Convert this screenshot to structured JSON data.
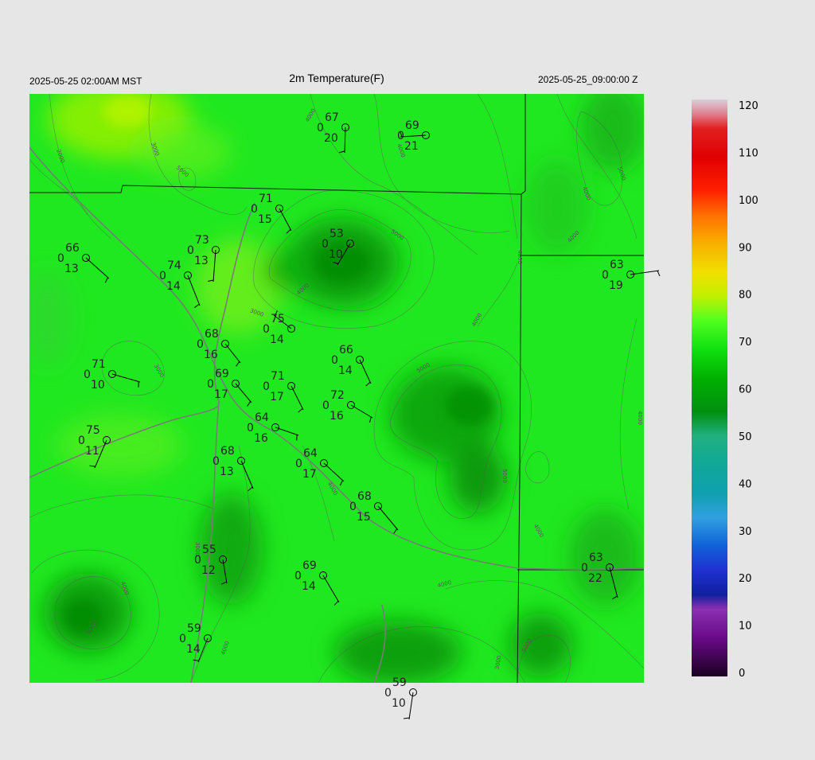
{
  "header": {
    "left_time": "2025-05-25 02:00AM MST",
    "title": "2m Temperature(F)",
    "right_time": "2025-05-25_09:00:00 Z"
  },
  "colorbar": {
    "labels": [
      "120",
      "110",
      "100",
      "90",
      "80",
      "70",
      "60",
      "50",
      "40",
      "30",
      "20",
      "10",
      "0"
    ],
    "stops": [
      {
        "v": 0,
        "c": "#1a0020"
      },
      {
        "v": 8,
        "c": "#6a0a8a"
      },
      {
        "v": 14,
        "c": "#8a30b0"
      },
      {
        "v": 17,
        "c": "#1020a0"
      },
      {
        "v": 22,
        "c": "#2030d0"
      },
      {
        "v": 27,
        "c": "#1060d8"
      },
      {
        "v": 33,
        "c": "#30a0e0"
      },
      {
        "v": 38,
        "c": "#10a0b0"
      },
      {
        "v": 44,
        "c": "#10a898"
      },
      {
        "v": 50,
        "c": "#20b080"
      },
      {
        "v": 55,
        "c": "#009010"
      },
      {
        "v": 62,
        "c": "#00b000"
      },
      {
        "v": 68,
        "c": "#10e010"
      },
      {
        "v": 74,
        "c": "#50ff20"
      },
      {
        "v": 79,
        "c": "#c0f000"
      },
      {
        "v": 84,
        "c": "#f0e000"
      },
      {
        "v": 90,
        "c": "#f8b000"
      },
      {
        "v": 96,
        "c": "#ff7000"
      },
      {
        "v": 101,
        "c": "#ff2000"
      },
      {
        "v": 108,
        "c": "#e00000"
      },
      {
        "v": 114,
        "c": "#e02020"
      },
      {
        "v": 117,
        "c": "#e08090"
      },
      {
        "v": 120,
        "c": "#d8d0d8"
      }
    ]
  },
  "contour_labels": [
    {
      "text": "2000"
    },
    {
      "text": "3000"
    },
    {
      "text": "5000"
    },
    {
      "text": "4000"
    },
    {
      "text": "5000"
    },
    {
      "text": "4000"
    },
    {
      "text": "3000"
    },
    {
      "text": "4000"
    },
    {
      "text": "3000"
    },
    {
      "text": "5000"
    },
    {
      "text": "4000"
    },
    {
      "text": "5000"
    },
    {
      "text": "4000"
    },
    {
      "text": "4000"
    },
    {
      "text": "5000"
    },
    {
      "text": "4000"
    },
    {
      "text": "3000"
    },
    {
      "text": "4000"
    },
    {
      "text": "4000"
    },
    {
      "text": "4000"
    },
    {
      "text": "4000"
    },
    {
      "text": "5000"
    },
    {
      "text": "4000"
    },
    {
      "text": "3000"
    },
    {
      "text": "5000"
    },
    {
      "text": "4000"
    }
  ],
  "stations": [
    {
      "temp": "67",
      "cloud": "0",
      "dew": "20"
    },
    {
      "temp": "69",
      "cloud": "0",
      "dew": "21"
    },
    {
      "temp": "71",
      "cloud": "0",
      "dew": "15"
    },
    {
      "temp": "53",
      "cloud": "0",
      "dew": "10"
    },
    {
      "temp": "66",
      "cloud": "0",
      "dew": "13"
    },
    {
      "temp": "73",
      "cloud": "0",
      "dew": "13"
    },
    {
      "temp": "74",
      "cloud": "0",
      "dew": "14"
    },
    {
      "temp": "63",
      "cloud": "0",
      "dew": "19"
    },
    {
      "temp": "75",
      "cloud": "0",
      "dew": "14"
    },
    {
      "temp": "68",
      "cloud": "0",
      "dew": "16"
    },
    {
      "temp": "66",
      "cloud": "0",
      "dew": "14"
    },
    {
      "temp": "71",
      "cloud": "0",
      "dew": "10"
    },
    {
      "temp": "69",
      "cloud": "0",
      "dew": "17"
    },
    {
      "temp": "71",
      "cloud": "0",
      "dew": "17"
    },
    {
      "temp": "72",
      "cloud": "0",
      "dew": "16"
    },
    {
      "temp": "64",
      "cloud": "0",
      "dew": "16"
    },
    {
      "temp": "75",
      "cloud": "0",
      "dew": "11"
    },
    {
      "temp": "68",
      "cloud": "0",
      "dew": "13"
    },
    {
      "temp": "64",
      "cloud": "0",
      "dew": "17"
    },
    {
      "temp": "68",
      "cloud": "0",
      "dew": "15"
    },
    {
      "temp": "55",
      "cloud": "0",
      "dew": "12"
    },
    {
      "temp": "69",
      "cloud": "0",
      "dew": "14"
    },
    {
      "temp": "63",
      "cloud": "0",
      "dew": "22"
    },
    {
      "temp": "59",
      "cloud": "0",
      "dew": "14"
    },
    {
      "temp": "59",
      "cloud": "0",
      "dew": "10"
    }
  ]
}
